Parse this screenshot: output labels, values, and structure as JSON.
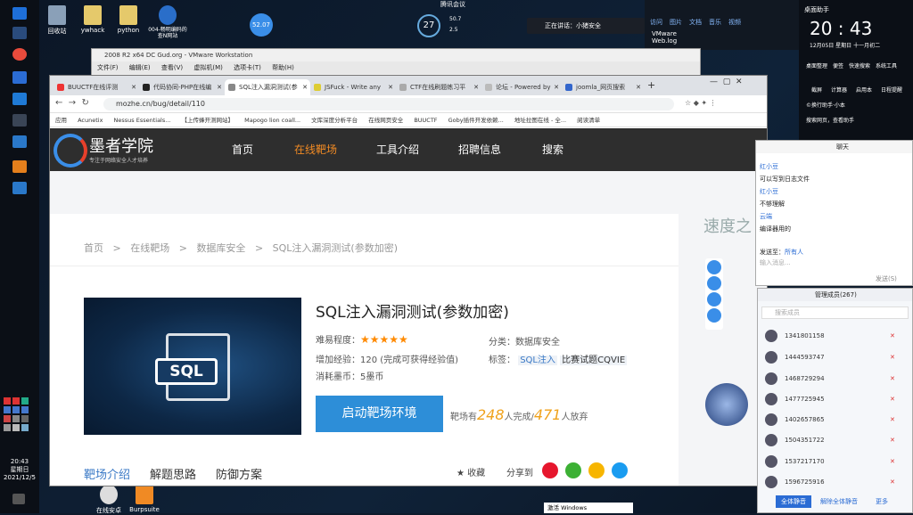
{
  "desktop": {
    "icons": [
      {
        "label": "回收站"
      },
      {
        "label": "ywhack"
      },
      {
        "label": "python"
      },
      {
        "label": "004-畅明编码的查N网站"
      },
      {
        "label": "在线安卓"
      },
      {
        "label": "Burpsuite"
      }
    ],
    "clock_widget": "52.07",
    "cpu_widget": "27",
    "net_up": "50.7",
    "net_down": "2.5",
    "topbar_label": "腾讯会议",
    "notice_text": "正在讲话：小猪安全",
    "taskbar_time": "20:43",
    "taskbar_weekday": "星期日",
    "taskbar_date": "2021/12/5",
    "activate_windows": "激活 Windows"
  },
  "file_panel": {
    "headers": [
      "访问",
      "图片",
      "文档",
      "音乐",
      "视频"
    ],
    "items": [
      "VMware",
      "Web.log"
    ]
  },
  "clock_panel": {
    "title": "桌面助手",
    "time": "20 : 43",
    "date": "12月05日 星期日 十一月初二",
    "actions": [
      "桌面整理",
      "便签",
      "快速搜索",
      "系统工具"
    ],
    "actions2": [
      "截屏",
      "计算器",
      "启用本",
      "日程提醒"
    ],
    "hint": "©换行助手·小本",
    "search_hint": "搜索网页，查看助手"
  },
  "vmware": {
    "title": "2008 R2 x64 DC Gud.org - VMware Workstation",
    "menu": [
      "文件(F)",
      "编辑(E)",
      "查看(V)",
      "虚拟机(M)",
      "选项卡(T)",
      "帮助(H)"
    ]
  },
  "browser": {
    "tabs": [
      {
        "label": "BUUCTF在线评测"
      },
      {
        "label": "代码协同-PHP在线编"
      },
      {
        "label": "SQL注入漏洞测试(参"
      },
      {
        "label": "JSFuck - Write any"
      },
      {
        "label": "CTF在线刷题练习平"
      },
      {
        "label": "论坛 - Powered by"
      },
      {
        "label": "joomla_网页搜索"
      }
    ],
    "url": "mozhe.cn/bug/detail/110",
    "bookmarks": [
      "应用",
      "Acunetix",
      "Nessus Essentials...",
      "【上传蜂开测网站】",
      "Mapogo lion coall...",
      "文库深度分析平台",
      "在线网页安全",
      "BUUCTF",
      "Goby插件开发依赖...",
      "地址拉图在线 - 全...",
      "阅读清单"
    ]
  },
  "site": {
    "logo_title": "墨者学院",
    "logo_sub": "专注于网络安全人才培养",
    "nav": [
      {
        "label": "首页",
        "active": false
      },
      {
        "label": "在线靶场",
        "active": true
      },
      {
        "label": "工具介绍",
        "active": false
      },
      {
        "label": "招聘信息",
        "active": false
      },
      {
        "label": "搜索",
        "active": false
      }
    ],
    "breadcrumb": [
      "首页",
      ">",
      "在线靶场",
      ">",
      "数据库安全",
      ">",
      "SQL注入漏洞测试(参数加密)"
    ],
    "side_title": "速度之",
    "challenge": {
      "title": "SQL注入漏洞测试(参数加密)",
      "difficulty_label": "难易程度：",
      "stars": 5,
      "exp_label": "增加经验：120 (完成可获得经验值)",
      "coin_label": "消耗墨币：5墨币",
      "category_label": "分类：数据库安全",
      "tags_label": "标签：",
      "tags": [
        "SQL注入",
        "比赛试题CQVIE"
      ],
      "launch_label": "启动靶场环境",
      "stats_prefix": "靶场有",
      "done_count": "248",
      "done_suffix": "人完成/",
      "quit_count": "471",
      "quit_suffix": "人放弃",
      "img_text": "SQL"
    },
    "bottom_tabs": [
      "靶场介绍",
      "解题思路",
      "防御方案"
    ],
    "bottom_actions": {
      "collect": "收藏",
      "share": "分享到"
    }
  },
  "chat": {
    "title": "聊天",
    "messages": [
      {
        "who": "红小豆",
        "text": "可以写到日志文件"
      },
      {
        "who": "红小豆",
        "text": "不够理解"
      },
      {
        "who": "云端",
        "text": "编译器用的"
      }
    ],
    "send_to_label": "发送至：",
    "send_to_value": "所有人",
    "input_placeholder": "输入消息...",
    "send_button": "发送(S)"
  },
  "members_panel": {
    "title": "管理成员(267)",
    "search_placeholder": "搜索成员",
    "members": [
      "1341801158",
      "1444593747",
      "1468729294",
      "1477725945",
      "1402657865",
      "1504351722",
      "1537217170",
      "1596725916"
    ],
    "mute_all": "全体静音",
    "unmute_all": "解除全体静音",
    "more": "更多"
  }
}
